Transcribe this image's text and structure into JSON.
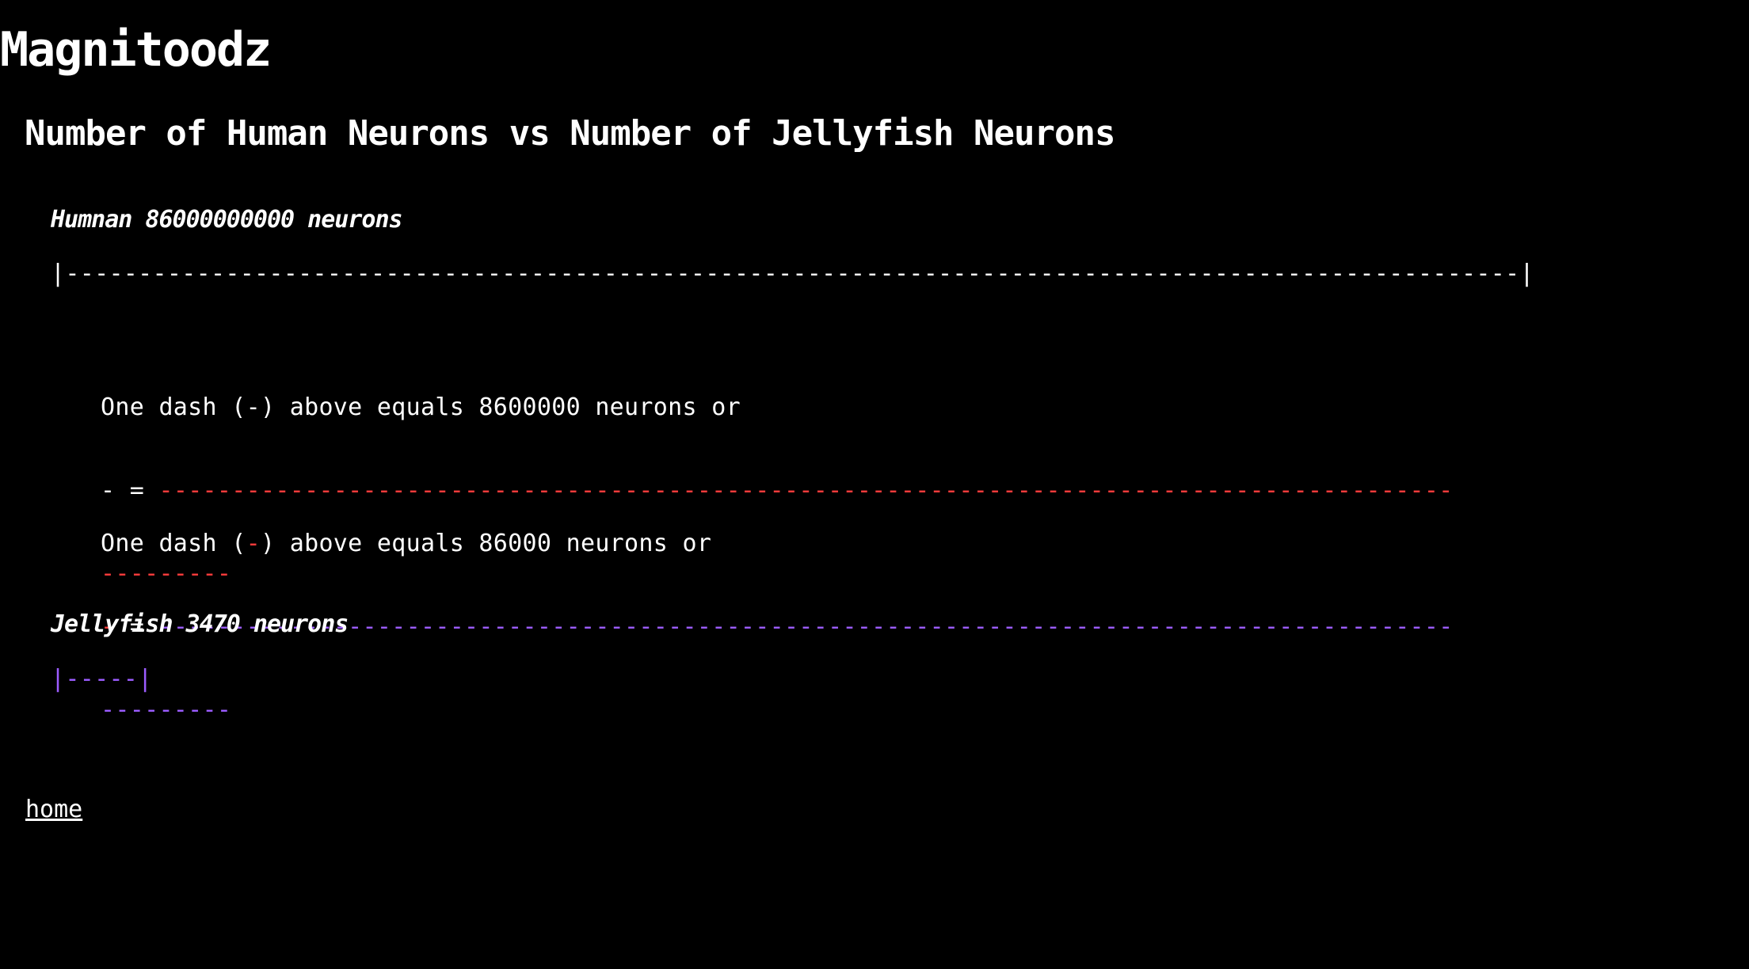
{
  "site": {
    "title": "Magnitoodz"
  },
  "page": {
    "title": "Number of Human Neurons vs Number of Jellyfish Neurons"
  },
  "human": {
    "label": "Humnan 86000000000 neurons",
    "bar": "|----------------------------------------------------------------------------------------------------|"
  },
  "scale1": {
    "text_before": "One dash (",
    "dash": "-",
    "text_after": ") above equals 8600000 neurons or",
    "eq_dash": "-",
    "eq_sign": " = ",
    "dashes_line1": "-----------------------------------------------------------------------------------------",
    "dashes_line2": "---------"
  },
  "scale2": {
    "text_before": "One dash (",
    "dash": "-",
    "text_after": ") above equals 86000 neurons or",
    "eq_dash": "-",
    "eq_sign": " = ",
    "dashes_line1": "-----------------------------------------------------------------------------------------",
    "dashes_line2": "---------"
  },
  "jellyfish": {
    "label": "Jellyfish 3470 neurons",
    "bar": "|-----|"
  },
  "footer": {
    "home_link": "home"
  },
  "colors": {
    "background": "#000000",
    "text": "#ffffff",
    "red_scale": "#ff3b3b",
    "purple_scale": "#9b5cff"
  }
}
